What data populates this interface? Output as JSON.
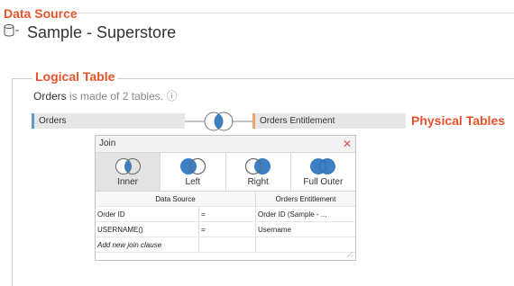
{
  "data_source": {
    "callout": "Data Source",
    "name": "Sample - Superstore",
    "icon": "database-icon"
  },
  "logical_table": {
    "callout": "Logical Table",
    "table_name": "Orders",
    "desc_rest": "is made of 2 tables.",
    "info_icon": "ⓘ"
  },
  "physical": {
    "left_table": "Orders",
    "right_table": "Orders Entitlement",
    "callout": "Physical Tables"
  },
  "join_dialog": {
    "title": "Join",
    "close": "✕",
    "types": [
      {
        "label": "Inner",
        "selected": true
      },
      {
        "label": "Left",
        "selected": false
      },
      {
        "label": "Right",
        "selected": false
      },
      {
        "label": "Full Outer",
        "selected": false
      }
    ],
    "columns": {
      "left": "Data Source",
      "right": "Orders Entitlement"
    },
    "clauses": [
      {
        "left": "Order ID",
        "op": "=",
        "right": "Order ID (Sample - ..."
      },
      {
        "left": "USERNAME()",
        "op": "=",
        "right": "Username"
      }
    ],
    "add_clause": "Add new join clause"
  },
  "colors": {
    "callout": "#e8532b",
    "join_blue": "#3b7fc4",
    "left_accent": "#5d9bcc",
    "right_accent": "#f2a466"
  }
}
